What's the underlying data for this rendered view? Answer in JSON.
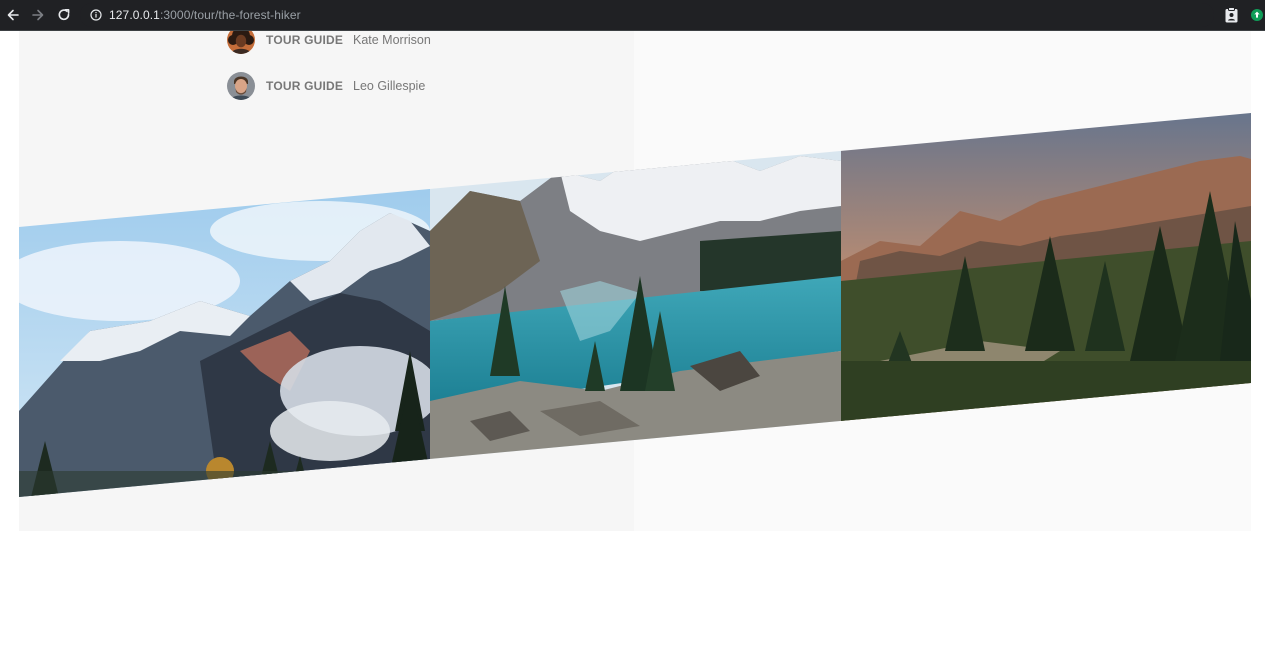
{
  "browser": {
    "url_host": "127.0.0.1",
    "url_rest": ":3000/tour/the-forest-hiker",
    "icons": {
      "back": "arrow-left-icon",
      "forward": "arrow-right-icon",
      "reload": "reload-icon",
      "site_info": "info-icon",
      "extension": "clipboard-icon",
      "profile": "profile-icon"
    }
  },
  "guides": [
    {
      "role": "TOUR GUIDE",
      "name": "Kate Morrison"
    },
    {
      "role": "TOUR GUIDE",
      "name": "Leo Gillespie"
    }
  ],
  "pictures": [
    {
      "subject": "snowy mountain peaks with clouds"
    },
    {
      "subject": "turquoise mountain lake with pine trees"
    },
    {
      "subject": "mountain ridge at sunset with pine forest"
    }
  ],
  "colors": {
    "chrome_bg": "#202124",
    "page_bg": "#ffffff",
    "panel_bg": "#f6f6f6",
    "text_muted": "#777777"
  }
}
